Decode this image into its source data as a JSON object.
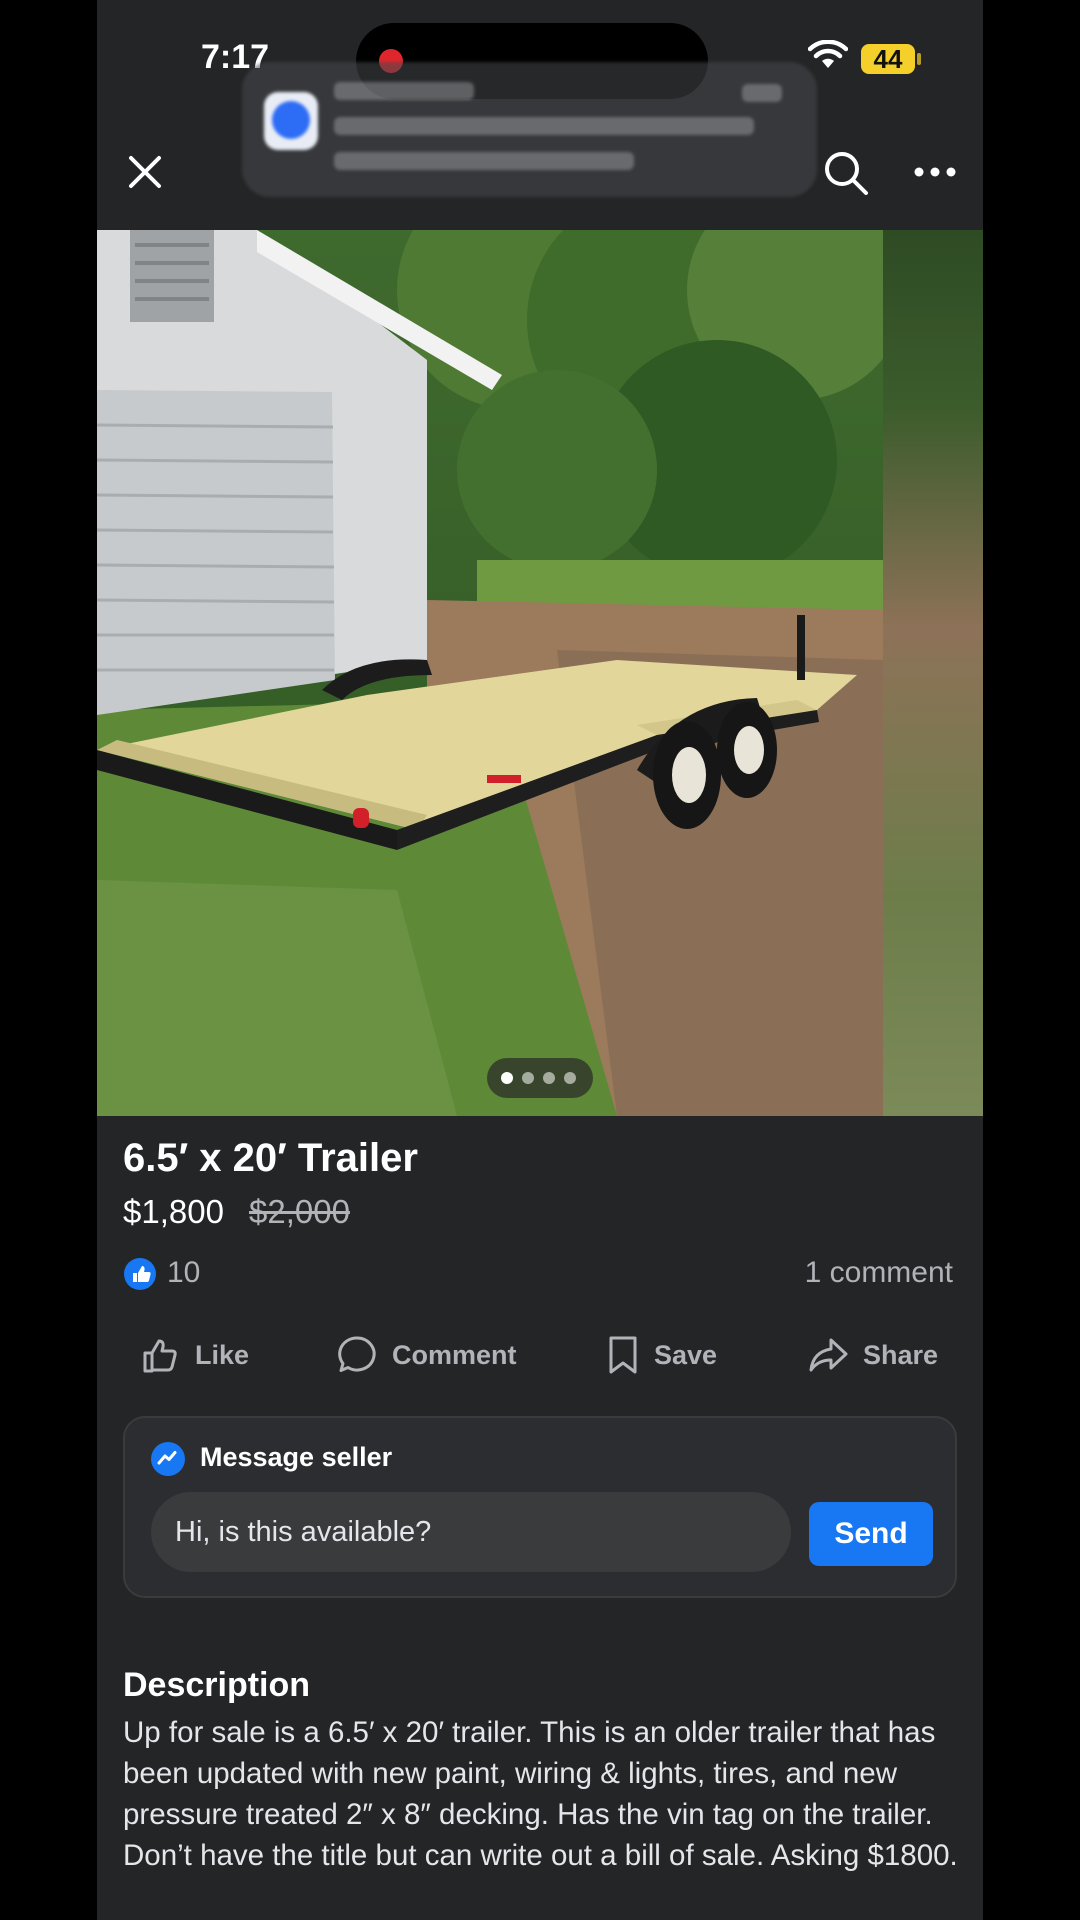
{
  "status_bar": {
    "time": "7:17",
    "battery": "44"
  },
  "listing": {
    "title": "6.5′ x 20′ Trailer",
    "price": "$1,800",
    "original_price": "$2,000",
    "like_count": "10",
    "comment_count": "1 comment",
    "photo_count": 4,
    "current_photo": 1
  },
  "actions": {
    "like": "Like",
    "comment": "Comment",
    "save": "Save",
    "share": "Share"
  },
  "message": {
    "title": "Message seller",
    "input_value": "Hi, is this available?",
    "send_label": "Send"
  },
  "description": {
    "heading": "Description",
    "body": "Up for sale is a 6.5′ x 20′ trailer. This is an older trailer that has been updated with new paint, wiring & lights, tires, and new pressure treated 2″ x 8″ decking. Has the vin tag on the trailer. Don’t have the title but can write out a bill of sale. Asking $1800."
  },
  "colors": {
    "accent": "#1877f2",
    "background": "#242526",
    "record": "#e0262d",
    "battery": "#f5d02a"
  }
}
